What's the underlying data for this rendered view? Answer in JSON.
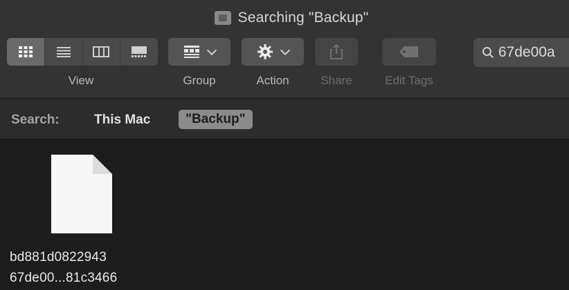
{
  "window": {
    "title": "Searching \"Backup\""
  },
  "toolbar": {
    "view_label": "View",
    "group_label": "Group",
    "action_label": "Action",
    "share_label": "Share",
    "edit_tags_label": "Edit Tags",
    "view_modes": [
      "icon-view-icon",
      "list-view-icon",
      "column-view-icon",
      "gallery-view-icon"
    ],
    "active_view_mode": "icon-view-icon"
  },
  "search": {
    "value": "67de00a"
  },
  "scope": {
    "label": "Search:",
    "location": "This Mac",
    "token": "\"Backup\""
  },
  "files": [
    {
      "name_line1": "bd881d0822943",
      "name_line2": "67de00...81c3466",
      "icon": "document-icon"
    }
  ],
  "colors": {
    "toolbar_bg": "#333333",
    "scope_bg": "#2c2c2c",
    "content_bg": "#1d1d1d",
    "pill_bg": "#8b8b8b"
  }
}
